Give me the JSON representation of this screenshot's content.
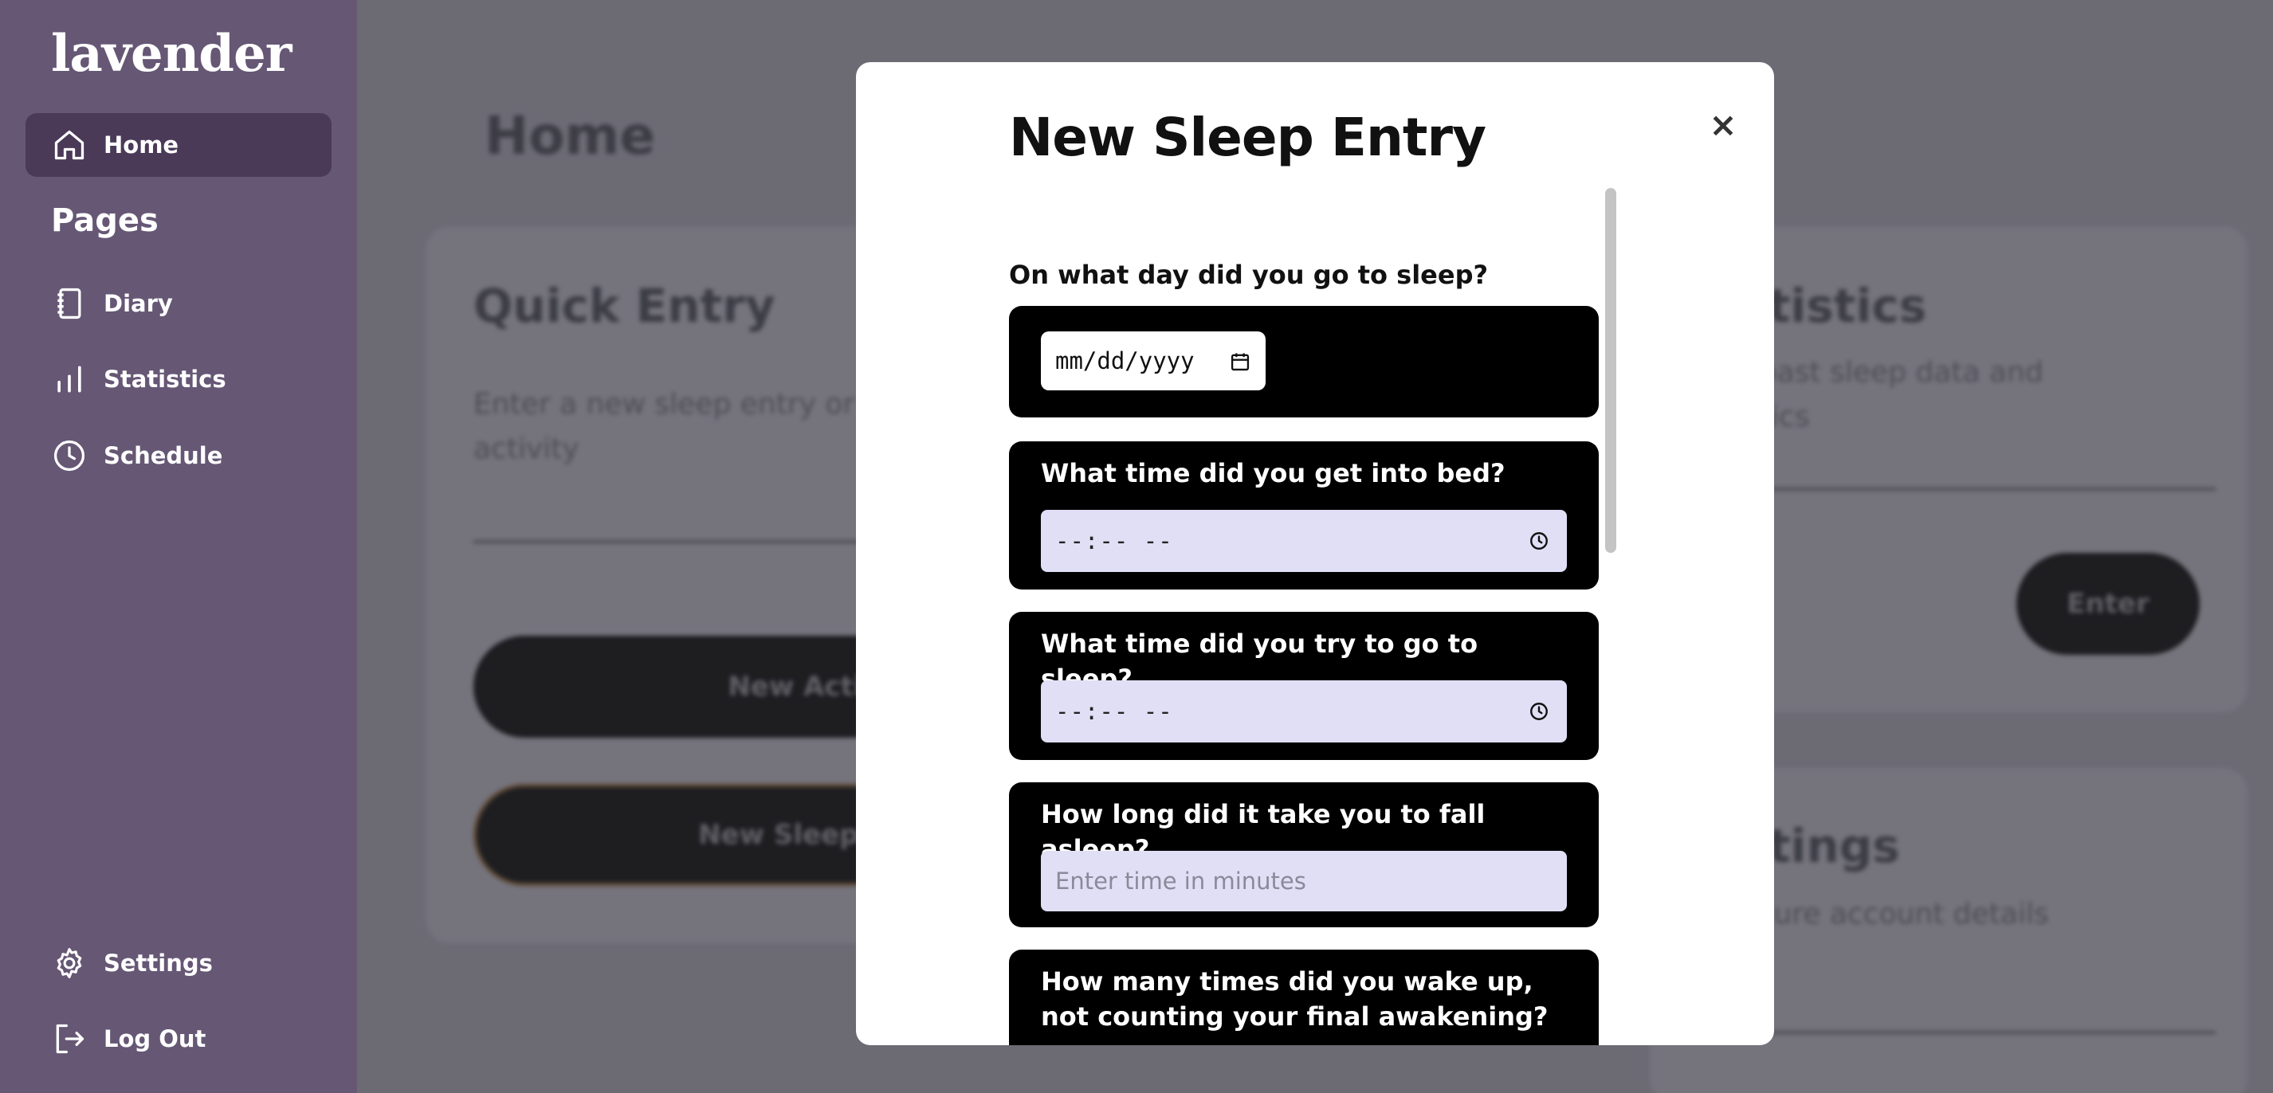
{
  "sidebar": {
    "logo": "lavender",
    "home": "Home",
    "pages_heading": "Pages",
    "items": [
      {
        "label": "Diary",
        "icon": "notebook-icon"
      },
      {
        "label": "Statistics",
        "icon": "bar-chart-icon"
      },
      {
        "label": "Schedule",
        "icon": "clock-icon"
      }
    ],
    "settings": "Settings",
    "logout": "Log Out",
    "bg_color": "#665775",
    "active_color": "#4a3a58"
  },
  "background": {
    "page_title": "Home",
    "quick_entry": {
      "title": "Quick Entry",
      "text": "Enter a new sleep entry or activity",
      "btn_activity": "New Activity",
      "btn_sleep": "New Sleep Entry"
    },
    "statistics": {
      "title": "Statistics",
      "text": "View past sleep data and statistics",
      "btn": "Enter"
    },
    "settings": {
      "title": "Settings",
      "text": "Configure account details"
    }
  },
  "modal": {
    "title": "New Sleep Entry",
    "close": "×",
    "date_question": "On what day did you go to sleep?",
    "date_placeholder": "mm/dd/yyyy",
    "questions": [
      {
        "label": "What time did you get into bed?",
        "value": "--:-- --"
      },
      {
        "label": "What time did you try to go to sleep?",
        "value": "--:-- --"
      },
      {
        "label": "How long did it take you to fall asleep?",
        "placeholder": "Enter time in minutes"
      },
      {
        "label": "How many times did you wake up, not counting your final awakening?"
      }
    ]
  }
}
